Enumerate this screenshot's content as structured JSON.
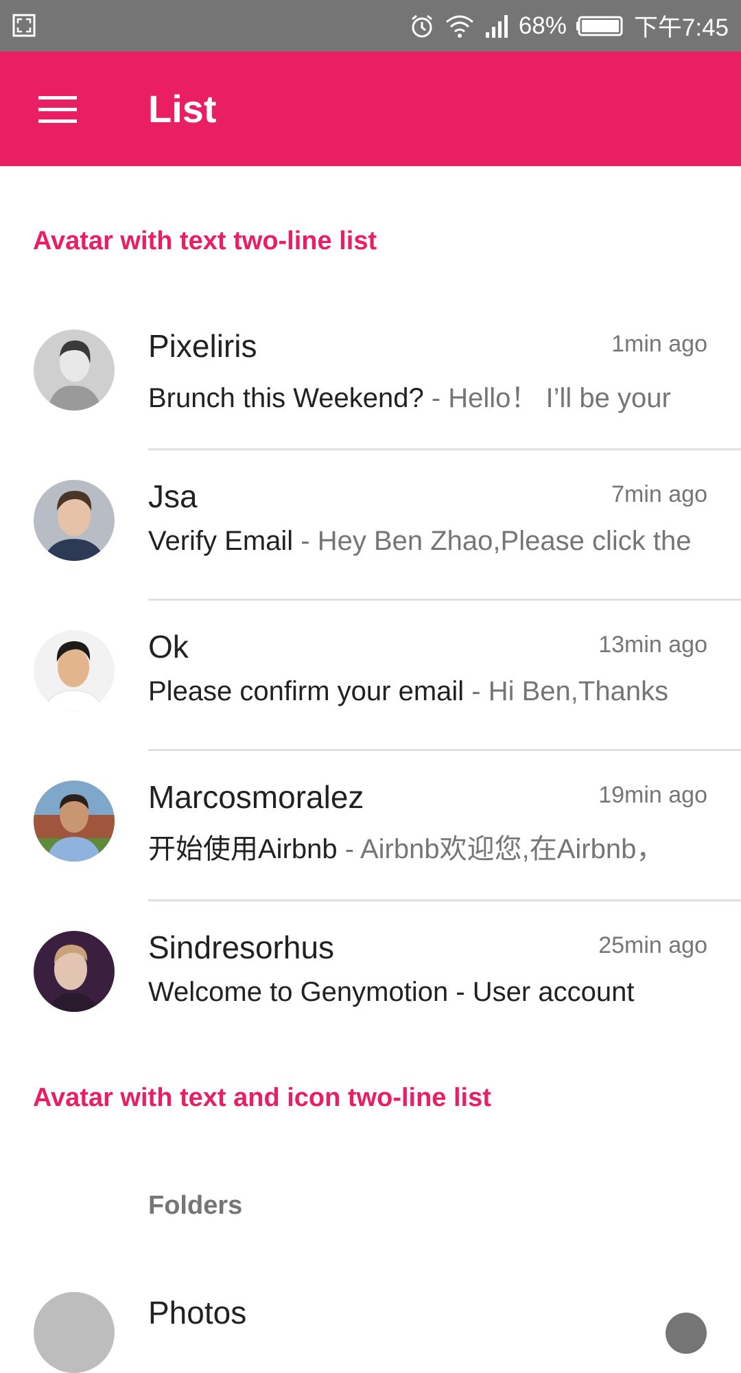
{
  "status_bar": {
    "battery": "68%",
    "time": "下午7:45",
    "icons": [
      "screenshot-icon",
      "alarm-icon",
      "wifi-icon",
      "signal-icon",
      "battery-icon"
    ]
  },
  "app_bar": {
    "title": "List",
    "background_color": "#E91E63",
    "menu_icon": "menu-icon"
  },
  "sections": {
    "text_list": {
      "header": "Avatar with text two-line list"
    },
    "icon_list": {
      "header": "Avatar with text and icon two-line list",
      "subheader": "Folders"
    }
  },
  "messages": [
    {
      "name": "Pixeliris",
      "time": "1min ago",
      "subject": "Brunch this Weekend?",
      "preview": " - Hello！ I’ll be your"
    },
    {
      "name": "Jsa",
      "time": "7min ago",
      "subject": "Verify Email",
      "preview": " - Hey Ben Zhao,Please click the"
    },
    {
      "name": "Ok",
      "time": "13min ago",
      "subject": "Please confirm your email",
      "preview": " - Hi Ben,Thanks"
    },
    {
      "name": "Marcosmoralez",
      "time": "19min ago",
      "subject": "开始使用Airbnb",
      "preview": " - Airbnb欢迎您,在Airbnb，"
    },
    {
      "name": "Sindresorhus",
      "time": "25min ago",
      "subject": "Welcome to Genymotion - User account",
      "preview": ""
    }
  ],
  "folders": [
    {
      "name": "Photos"
    }
  ],
  "colors": {
    "accent": "#E91E63",
    "status_bar": "#757575",
    "primary_text": "#212121",
    "secondary_text": "#757575",
    "divider": "#e0e0e0"
  }
}
